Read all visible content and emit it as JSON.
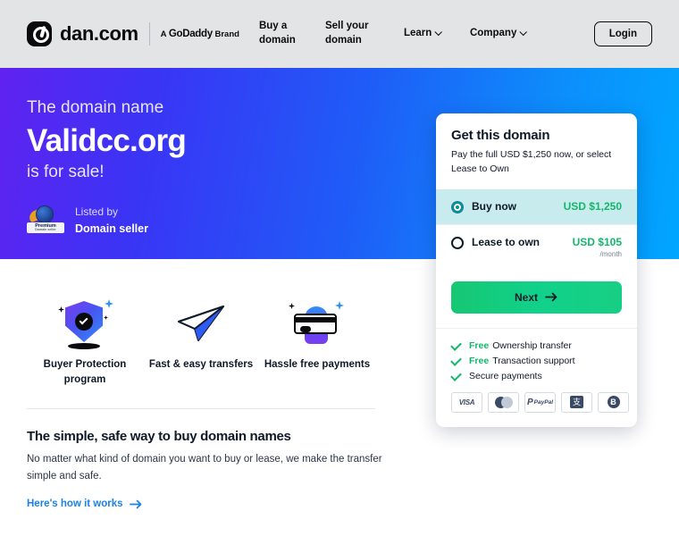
{
  "header": {
    "logo_text": "dan.com",
    "logo_icon": "dan-logo-icon",
    "brand_prefix": "A",
    "brand_name": "GoDaddy",
    "brand_suffix": "Brand",
    "nav": [
      {
        "label": "Buy a domain",
        "has_chevron": false
      },
      {
        "label": "Sell your domain",
        "has_chevron": false
      },
      {
        "label": "Learn",
        "has_chevron": true
      },
      {
        "label": "Company",
        "has_chevron": true
      }
    ],
    "login_label": "Login"
  },
  "hero": {
    "line1": "The domain name",
    "domain": "Validcc.org",
    "line3": "is for sale!",
    "badge_label": "Premium",
    "badge_sub": "Domain seller",
    "listed_by_label": "Listed by",
    "seller": "Domain seller",
    "gradient_from": "#6022f0",
    "gradient_to": "#00a6ff"
  },
  "card": {
    "title": "Get this domain",
    "subtitle": "Pay the full USD $1,250 now, or select Lease to Own",
    "options": [
      {
        "label": "Buy now",
        "price": "USD $1,250",
        "per": "",
        "selected": true
      },
      {
        "label": "Lease to own",
        "price": "USD $105",
        "per": "/month",
        "selected": false
      }
    ],
    "next_label": "Next",
    "next_icon": "arrow-right-icon",
    "benefits": [
      {
        "free": "Free",
        "text": "Ownership transfer"
      },
      {
        "free": "Free",
        "text": "Transaction support"
      },
      {
        "free": "",
        "text": "Secure payments"
      }
    ],
    "payment_methods": [
      "visa-icon",
      "mastercard-icon",
      "paypal-icon",
      "alipay-icon",
      "bitcoin-icon"
    ],
    "visa_label": "VISA",
    "paypal_label": "PayPal",
    "bitcoin_label": "Ƀ",
    "accent_green": "#12b76a",
    "selected_bg": "#c8ecee"
  },
  "features": [
    {
      "icon": "shield-check-icon",
      "label": "Buyer Protection program"
    },
    {
      "icon": "paper-plane-icon",
      "label": "Fast & easy transfers"
    },
    {
      "icon": "hand-card-icon",
      "label": "Hassle free payments"
    }
  ],
  "bottom": {
    "title": "The simple, safe way to buy domain names",
    "text": "No matter what kind of domain you want to buy or lease, we make the transfer simple and safe.",
    "link_label": "Here's how it works",
    "link_icon": "arrow-right-icon",
    "link_color": "#1a82e2"
  }
}
